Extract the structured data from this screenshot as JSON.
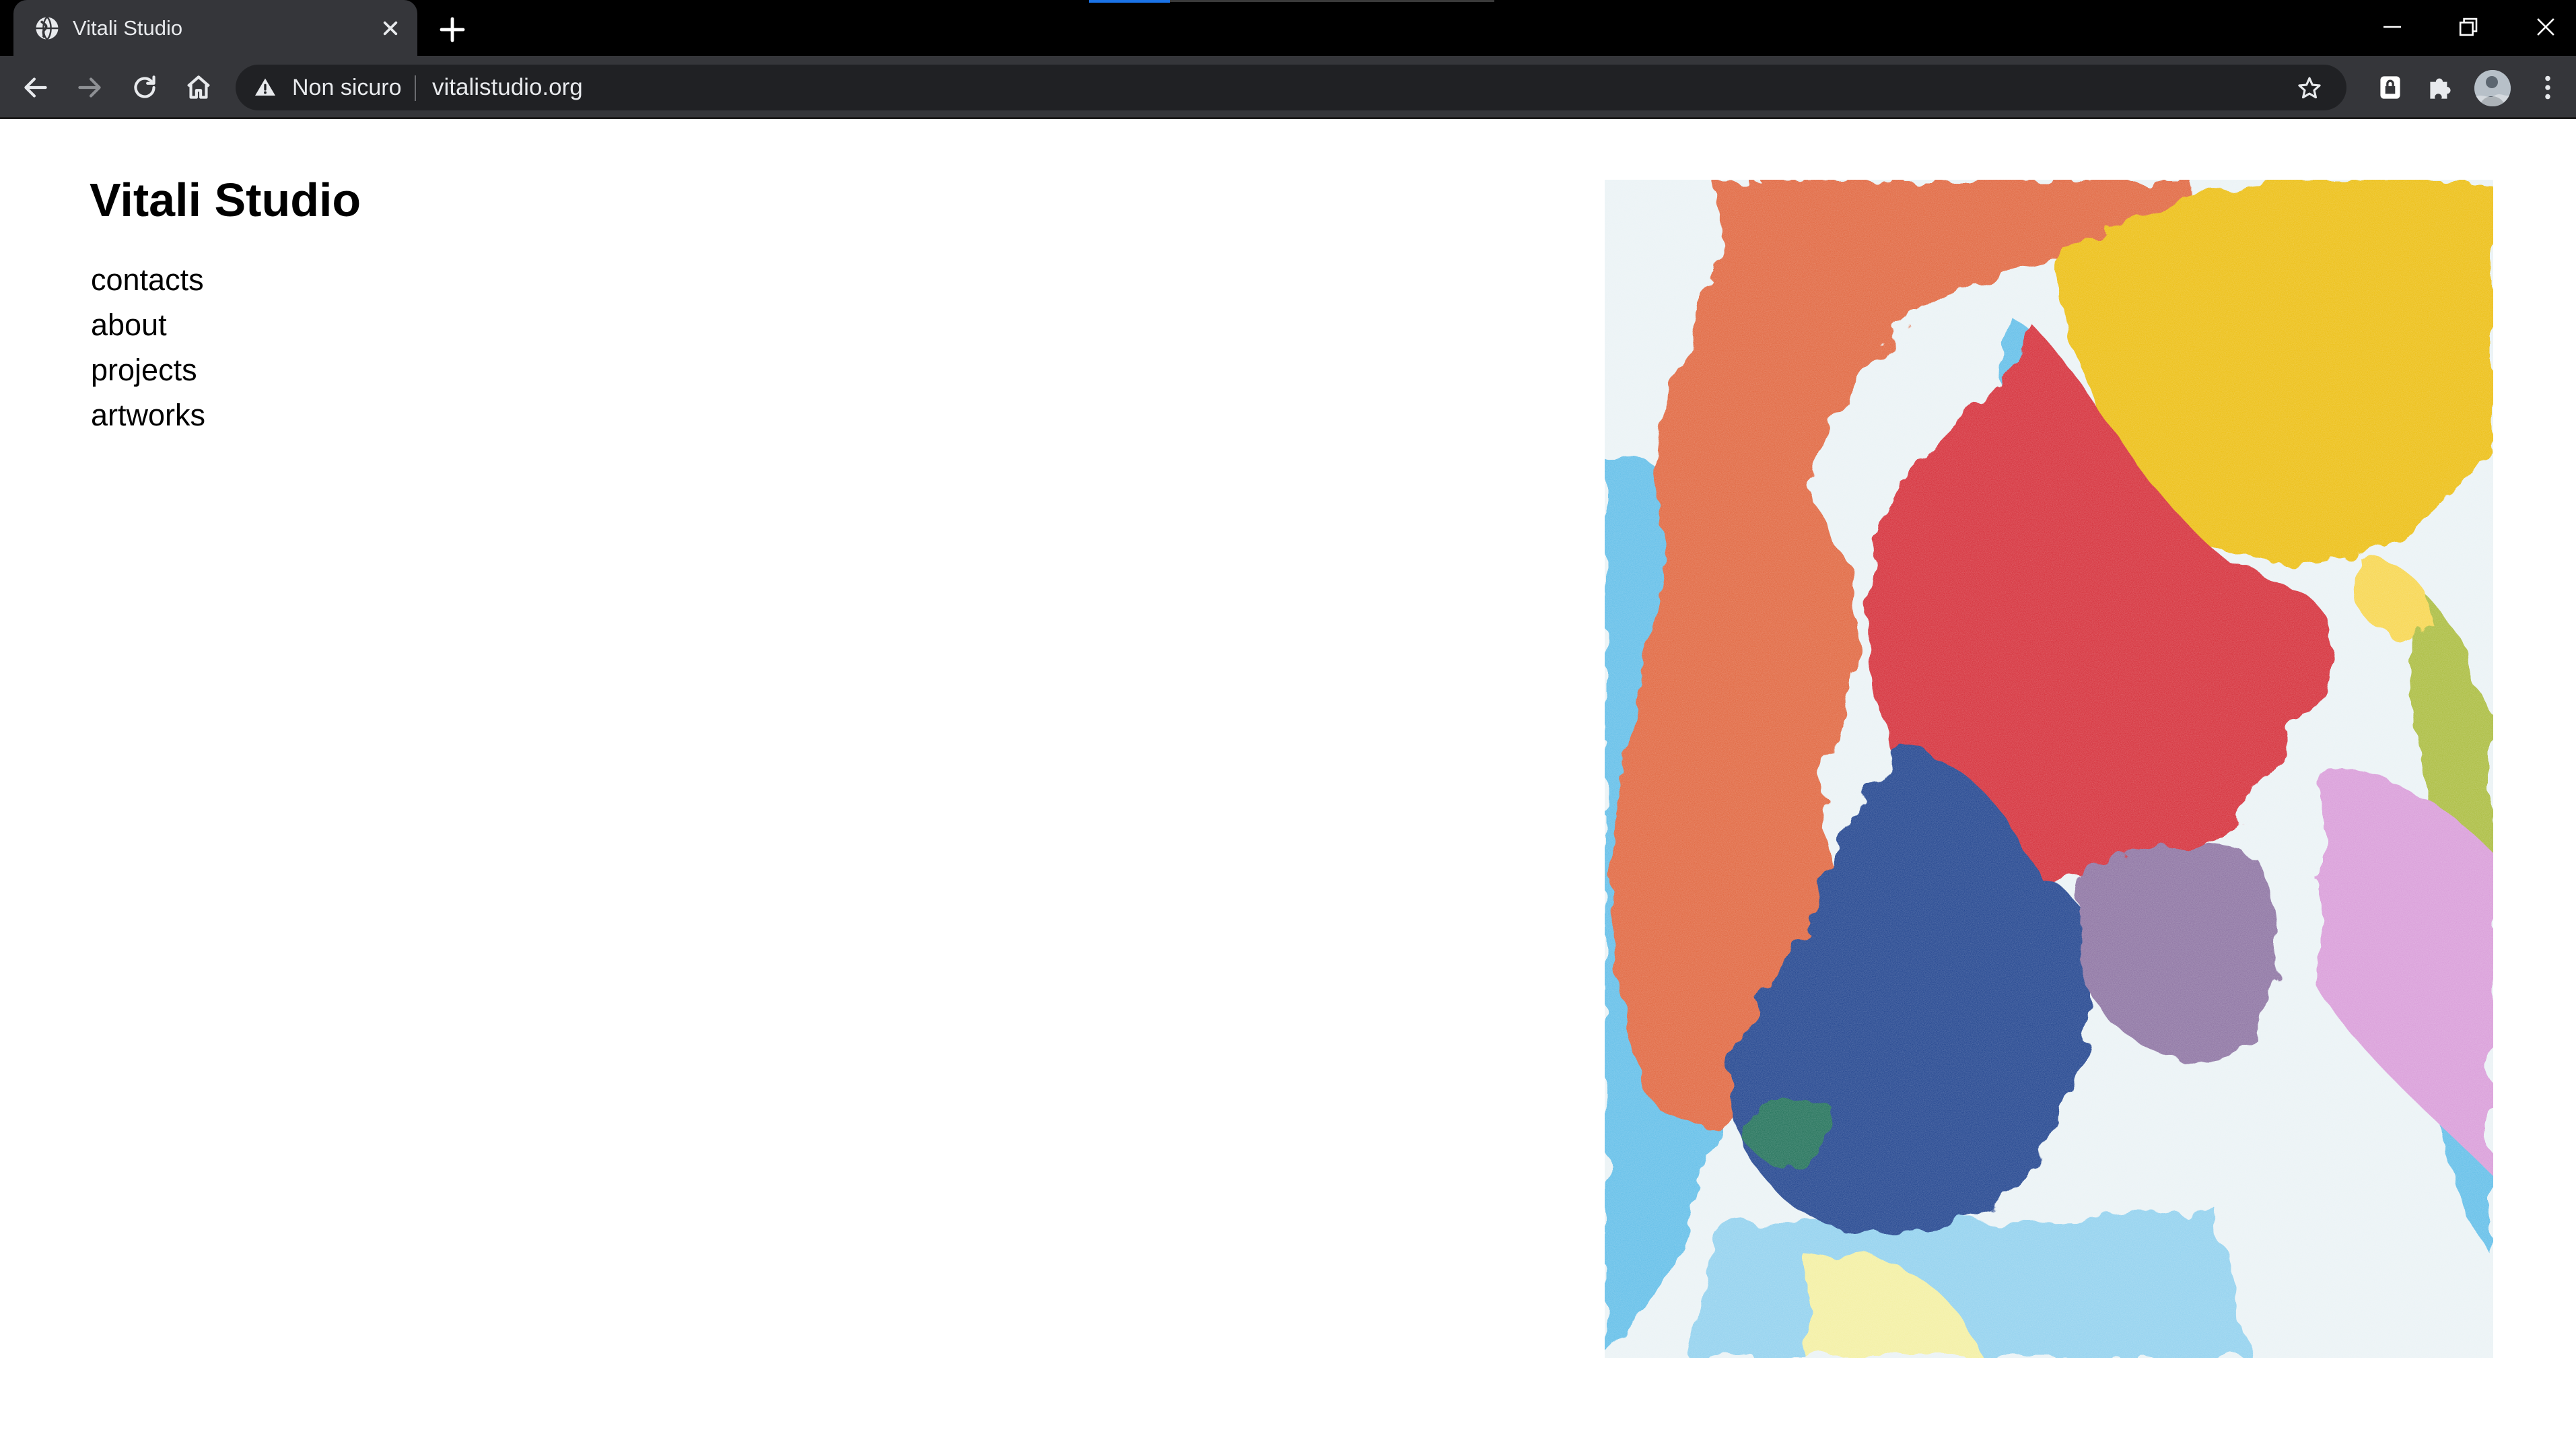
{
  "browser": {
    "tab": {
      "title": "Vitali Studio",
      "favicon_icon": "globe-icon",
      "close_icon": "close-icon"
    },
    "new_tab_icon": "plus-icon",
    "window_controls": [
      "minimize-icon",
      "restore-icon",
      "close-icon"
    ],
    "toolbar": {
      "back_icon": "arrow-left-icon",
      "forward_icon": "arrow-right-icon",
      "reload_icon": "reload-icon",
      "home_icon": "home-icon",
      "security_icon": "warning-icon",
      "security_text": "Non sicuro",
      "url": "vitalistudio.org",
      "bookmark_icon": "star-icon",
      "extensions": [
        "lock-extension-icon",
        "puzzle-icon"
      ],
      "profile": "avatar",
      "menu_icon": "more-vertical-icon"
    },
    "colors": {
      "frame": "#000000",
      "toolbar": "#35363a",
      "omnibox": "#202124",
      "text": "#e8eaed",
      "accent": "#1a73e8"
    }
  },
  "page": {
    "site_title": "Vitali Studio",
    "nav": [
      "contacts",
      "about",
      "projects",
      "artworks"
    ],
    "artwork": {
      "kind": "abstract painting",
      "colors": [
        "#e0643a",
        "#d42a35",
        "#1e3f8c",
        "#ecbd10",
        "#8a6fa0",
        "#5fbde8",
        "#a9bb3a",
        "#d89ad8"
      ]
    },
    "background": "#ffffff"
  }
}
